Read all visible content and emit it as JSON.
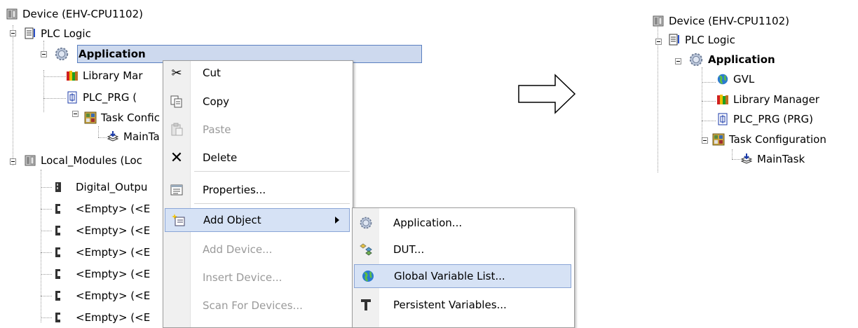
{
  "left_tree": {
    "device": "Device (EHV-CPU1102)",
    "plc_logic": "PLC Logic",
    "application": "Application",
    "library_manager": "Library Mar",
    "plc_prg": "PLC_PRG (",
    "task_config": "Task Confic",
    "main_task": "MainTa",
    "local_modules": "Local_Modules (Loc",
    "digital_output": "Digital_Outpu",
    "empty_rows": [
      "<Empty> (<E",
      "<Empty> (<E",
      "<Empty> (<E",
      "<Empty> (<E",
      "<Empty> (<E",
      "<Empty> (<E"
    ]
  },
  "context_menu": {
    "items": [
      {
        "label": "Cut",
        "icon": "scissors-icon",
        "enabled": true
      },
      {
        "label": "Copy",
        "icon": "copy-icon",
        "enabled": true
      },
      {
        "label": "Paste",
        "icon": "paste-icon",
        "enabled": false
      },
      {
        "label": "Delete",
        "icon": "delete-icon",
        "enabled": true
      },
      {
        "label": "Properties...",
        "icon": "properties-icon",
        "enabled": true
      },
      {
        "label": "Add Object",
        "icon": "add-object-icon",
        "enabled": true,
        "highlighted": true,
        "has_submenu": true
      },
      {
        "label": "Add Device...",
        "enabled": false
      },
      {
        "label": "Insert Device...",
        "enabled": false
      },
      {
        "label": "Scan For Devices...",
        "enabled": false
      }
    ]
  },
  "submenu": {
    "items": [
      {
        "label": "Application...",
        "icon": "gear-icon"
      },
      {
        "label": "DUT...",
        "icon": "dut-icon"
      },
      {
        "label": "Global Variable List...",
        "icon": "globe-icon",
        "highlighted": true
      },
      {
        "label": "Persistent Variables...",
        "icon": "persistent-icon"
      }
    ]
  },
  "right_tree": {
    "device": "Device (EHV-CPU1102)",
    "plc_logic": "PLC Logic",
    "application": "Application",
    "gvl": "GVL",
    "library_manager": "Library Manager",
    "plc_prg": "PLC_PRG (PRG)",
    "task_config": "Task Configuration",
    "main_task": "MainTask"
  },
  "colors": {
    "selection": "#cdd9ee",
    "selection_border": "#5a7fc0",
    "menu_hot": "#d6e2f5",
    "disabled_text": "#9a9a9a"
  }
}
